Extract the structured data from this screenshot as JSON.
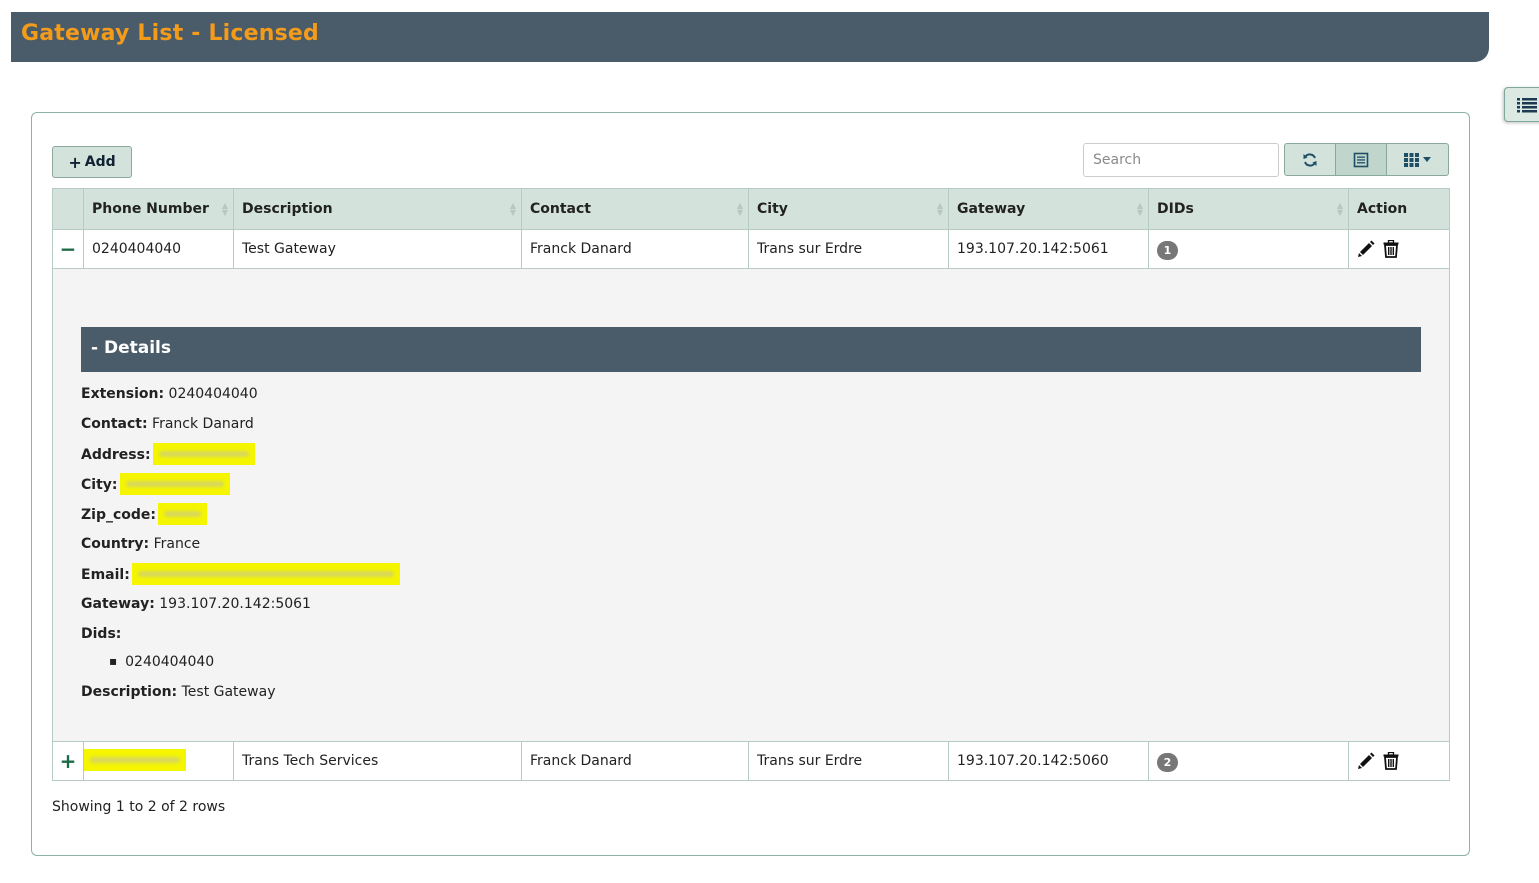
{
  "header": {
    "title": "Gateway List - Licensed"
  },
  "toolbar": {
    "add_label": "Add",
    "search_placeholder": "Search"
  },
  "table": {
    "columns": [
      "Phone Number",
      "Description",
      "Contact",
      "City",
      "Gateway",
      "DIDs",
      "Action"
    ],
    "rows": [
      {
        "toggle": "−",
        "phone": "0240404040",
        "description": "Test Gateway",
        "contact": "Franck Danard",
        "city": "Trans sur Erdre",
        "gateway": "193.107.20.142:5061",
        "dids": "1"
      },
      {
        "toggle": "+",
        "phone": "",
        "description": "Trans Tech Services",
        "contact": "Franck Danard",
        "city": "Trans sur Erdre",
        "gateway": "193.107.20.142:5060",
        "dids": "2"
      }
    ]
  },
  "details": {
    "title": "- Details",
    "extension_label": "Extension:",
    "extension": "0240404040",
    "contact_label": "Contact:",
    "contact": "Franck Danard",
    "address_label": "Address:",
    "city_label": "City:",
    "zip_label": "Zip_code:",
    "country_label": "Country:",
    "country": "France",
    "email_label": "Email:",
    "gateway_label": "Gateway:",
    "gateway": "193.107.20.142:5061",
    "dids_label": "Dids:",
    "dids": [
      "0240404040"
    ],
    "description_label": "Description:",
    "description": "Test Gateway"
  },
  "footer": {
    "pagination_text": "Showing 1 to 2 of 2 rows"
  },
  "colors": {
    "title_bar": "#4a5c69",
    "title_text": "#f49b1a",
    "header_row": "#d3e3dc",
    "redaction_highlight": "#f5f500",
    "toggle_icon": "#1e6a47"
  }
}
